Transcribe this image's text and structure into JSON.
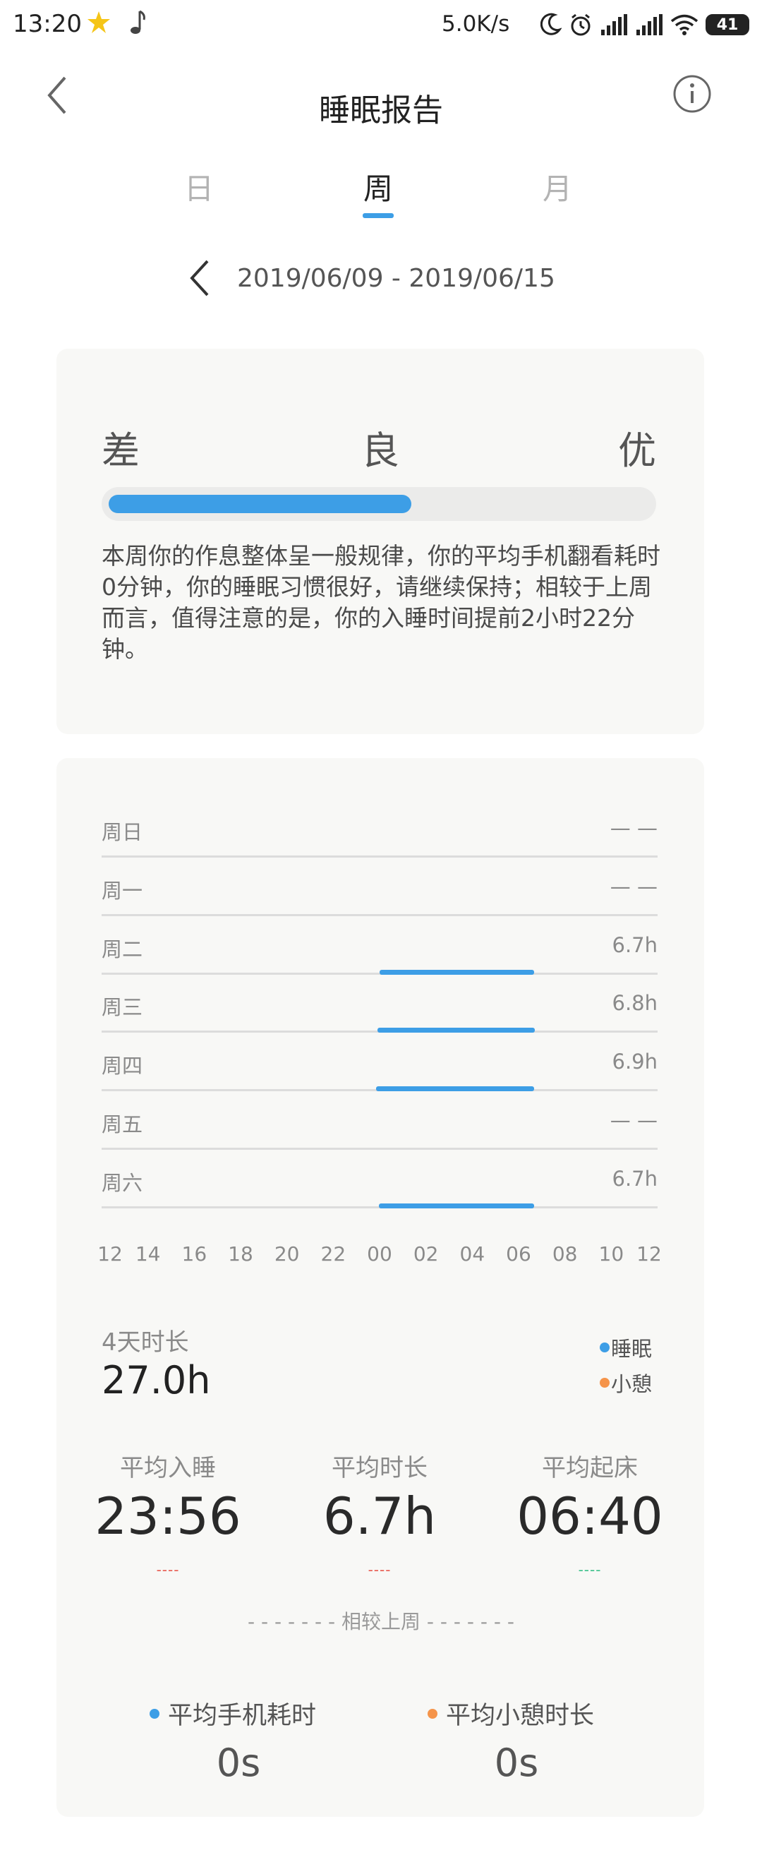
{
  "status_bar": {
    "time": "13:20",
    "speed": "5.0K/s",
    "battery": "41",
    "icons": [
      "star-icon",
      "music-note-icon",
      "moon-icon",
      "alarm-icon",
      "signal-icon",
      "signal-icon",
      "wifi-icon",
      "battery-icon"
    ]
  },
  "header": {
    "title": "睡眠报告",
    "back_icon": "chevron-left-icon",
    "info_icon": "info-icon"
  },
  "tabs": [
    {
      "label": "日",
      "active": false
    },
    {
      "label": "周",
      "active": true
    },
    {
      "label": "月",
      "active": false
    }
  ],
  "date_nav": {
    "range": "2019/06/09 - 2019/06/15"
  },
  "quality": {
    "labels": [
      "差",
      "良",
      "优"
    ],
    "level": 0.56,
    "summary": "本周你的作息整体呈一般规律，你的平均手机翻看耗时0分钟，你的睡眠习惯很好，请继续保持；相较于上周而言，值得注意的是，你的入睡时间提前2小时22分钟。"
  },
  "chart_data": {
    "type": "bar",
    "orientation": "horizontal-range",
    "x_ticks": [
      "12",
      "14",
      "16",
      "18",
      "20",
      "22",
      "00",
      "02",
      "04",
      "06",
      "08",
      "10",
      "12"
    ],
    "days": [
      {
        "label": "周日",
        "value": "— —",
        "start": null,
        "end": null
      },
      {
        "label": "周一",
        "value": "— —",
        "start": null,
        "end": null
      },
      {
        "label": "周二",
        "value": "6.7h",
        "start": "00:00",
        "end": "06:40"
      },
      {
        "label": "周三",
        "value": "6.8h",
        "start": "23:54",
        "end": "06:42"
      },
      {
        "label": "周四",
        "value": "6.9h",
        "start": "23:50",
        "end": "06:40"
      },
      {
        "label": "周五",
        "value": "— —",
        "start": null,
        "end": null
      },
      {
        "label": "周六",
        "value": "6.7h",
        "start": "23:58",
        "end": "06:40"
      }
    ],
    "series_colors": {
      "sleep": "#3d9ee6",
      "nap": "#f5944a"
    }
  },
  "totals": {
    "label": "4天时长",
    "value": "27.0h"
  },
  "legend": [
    {
      "label": "睡眠",
      "color": "#3d9ee6"
    },
    {
      "label": "小憩",
      "color": "#f5944a"
    }
  ],
  "stats": [
    {
      "label": "平均入睡",
      "value": "23:56",
      "dash": "----",
      "dash_color": "#e85a50"
    },
    {
      "label": "平均时长",
      "value": "6.7h",
      "dash": "----",
      "dash_color": "#e85a50"
    },
    {
      "label": "平均起床",
      "value": "06:40",
      "dash": "----",
      "dash_color": "#3cc08a"
    }
  ],
  "compare_label": "- - - - - - - 相较上周 - - - - - - -",
  "bottom_stats": [
    {
      "label": "平均手机耗时",
      "value": "0s",
      "dot_color": "#3d9ee6"
    },
    {
      "label": "平均小憩时长",
      "value": "0s",
      "dot_color": "#f5944a"
    }
  ]
}
